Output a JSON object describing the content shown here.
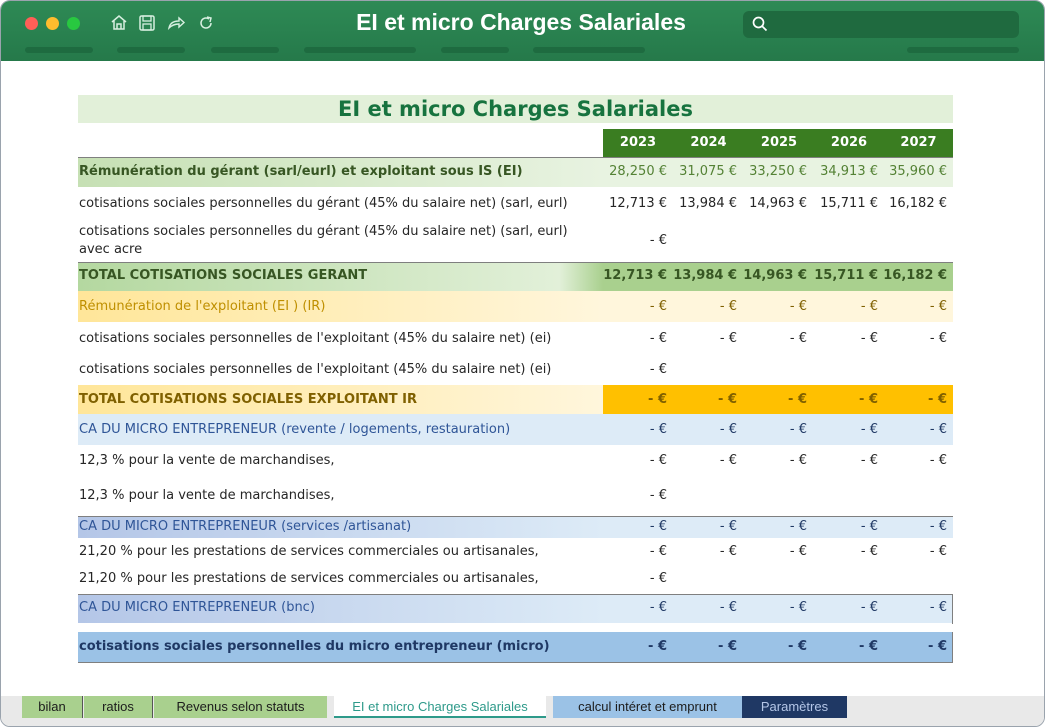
{
  "window": {
    "title": "EI et micro Charges Salariales"
  },
  "sheet": {
    "title": "EI et micro Charges Salariales",
    "years": [
      "2023",
      "2024",
      "2025",
      "2026",
      "2027"
    ],
    "rows": [
      {
        "label": "Rémunération du gérant (sarl/eurl) et exploitant sous IS (EI)",
        "values": [
          "28,250 €",
          "31,075 €",
          "33,250 €",
          "34,913 €",
          "35,960 €"
        ]
      },
      {
        "label": "cotisations sociales personnelles du gérant (45% du salaire net) (sarl, eurl)",
        "values": [
          "12,713 €",
          "13,984 €",
          "14,963 €",
          "15,711 €",
          "16,182 €"
        ]
      },
      {
        "label": "cotisations sociales personnelles du gérant (45% du salaire net) (sarl, eurl)",
        "label2": "avec acre",
        "values": [
          "-  €"
        ]
      },
      {
        "label": "TOTAL COTISATIONS SOCIALES GERANT",
        "values": [
          "12,713 €",
          "13,984 €",
          "14,963 €",
          "15,711 €",
          "16,182 €"
        ]
      },
      {
        "label": "Rémunération de l'exploitant (EI ) (IR)",
        "values": [
          "-  €",
          "-  €",
          "-  €",
          "-  €",
          "-  €"
        ]
      },
      {
        "label": "cotisations sociales personnelles de l'exploitant (45% du salaire net) (ei)",
        "values": [
          "-  €",
          "-  €",
          "-  €",
          "-  €",
          "-  €"
        ]
      },
      {
        "label": "cotisations sociales personnelles de l'exploitant (45% du salaire net) (ei)",
        "values": [
          "-  €"
        ]
      },
      {
        "label": "TOTAL COTISATIONS SOCIALES EXPLOITANT IR",
        "values": [
          "-  €",
          "-  €",
          "-  €",
          "-  €",
          "-  €"
        ]
      },
      {
        "label": "CA DU MICRO ENTREPRENEUR (revente / logements, restauration)",
        "values": [
          "-  €",
          "-  €",
          "-  €",
          "-  €",
          "-  €"
        ]
      },
      {
        "label": "12,3 % pour la vente de marchandises,",
        "values": [
          "-  €",
          "-  €",
          "-  €",
          "-  €",
          "-  €"
        ]
      },
      {
        "label": "12,3 % pour la vente de marchandises,",
        "values": [
          "-  €"
        ]
      },
      {
        "label": "CA DU MICRO ENTREPRENEUR (services /artisanat)",
        "values": [
          "-  €",
          "-  €",
          "-  €",
          "-  €",
          "-  €"
        ]
      },
      {
        "label": "21,20 % pour les prestations de services commerciales ou artisanales,",
        "values": [
          "-  €",
          "-  €",
          "-  €",
          "-  €",
          "-  €"
        ]
      },
      {
        "label": "21,20 % pour les prestations de services commerciales ou artisanales,",
        "values": [
          "-  €"
        ]
      },
      {
        "label": "CA DU MICRO ENTREPRENEUR (bnc)",
        "values": [
          "-  €",
          "-  €",
          "-  €",
          "-  €",
          "-  €"
        ]
      },
      {
        "label": "cotisations sociales personnelles du micro entrepreneur  (micro)",
        "values": [
          "-  €",
          "-  €",
          "-  €",
          "-  €",
          "-  €"
        ]
      }
    ]
  },
  "tabs": [
    {
      "label": "bilan",
      "color": "#a9d08e"
    },
    {
      "label": "ratios",
      "color": "#a9d08e"
    },
    {
      "label": "Revenus selon statuts",
      "color": "#a9d08e"
    },
    {
      "label": "EI et micro Charges Salariales",
      "color": "#ffffff",
      "active": true
    },
    {
      "label": "calcul intéret et emprunt",
      "color": "#9bc2e6"
    },
    {
      "label": "Paramètres",
      "color": "#1f3864"
    }
  ],
  "colors": {
    "titlebar": "#2e8a55",
    "header_green": "#3a7d21",
    "light_green": "#e2f0d9",
    "orange": "#ffc000",
    "light_orange": "#fff2cc",
    "blue": "#9bc2e6",
    "light_blue": "#ddebf7"
  }
}
